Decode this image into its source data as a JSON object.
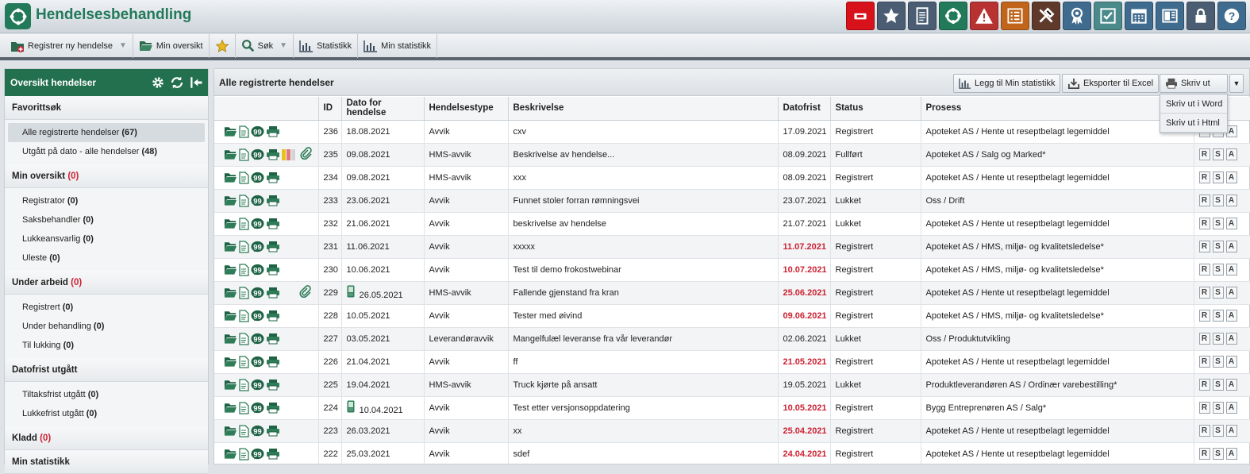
{
  "app": {
    "title": "Hendelsesbehandling"
  },
  "header_icons": [
    {
      "name": "notification-icon",
      "color": "#d8121a"
    },
    {
      "name": "star-icon",
      "color": "#4a5d73"
    },
    {
      "name": "document-icon",
      "color": "#4a5d73"
    },
    {
      "name": "cycle-icon",
      "color": "#237a5a"
    },
    {
      "name": "warning-icon",
      "color": "#b83232"
    },
    {
      "name": "list-icon",
      "color": "#c0651b"
    },
    {
      "name": "tools-icon",
      "color": "#5f3a2a"
    },
    {
      "name": "award-icon",
      "color": "#3f6b8e"
    },
    {
      "name": "checkbox-icon",
      "color": "#4a8a8a"
    },
    {
      "name": "calendar-icon",
      "color": "#3f6b8e"
    },
    {
      "name": "publish-icon",
      "color": "#3f6b8e"
    },
    {
      "name": "lock-icon",
      "color": "#4a5d73"
    },
    {
      "name": "help-icon",
      "color": "#3f6b8e"
    }
  ],
  "toolbar": {
    "register": "Registrer ny hendelse",
    "my_overview": "Min oversikt",
    "search": "Søk",
    "statistics": "Statistikk",
    "my_statistics": "Min statistikk"
  },
  "sidebar": {
    "title": "Oversikt hendelser",
    "favorites_title": "Favorittsøk",
    "favorites": [
      {
        "label": "Alle registrerte hendelser",
        "count": "(67)"
      },
      {
        "label": "Utgått på dato - alle hendelser",
        "count": "(48)"
      }
    ],
    "my_overview_title": "Min oversikt",
    "my_overview_count": "(0)",
    "my_overview": [
      {
        "label": "Registrator",
        "count": "(0)"
      },
      {
        "label": "Saksbehandler",
        "count": "(0)"
      },
      {
        "label": "Lukkeansvarlig",
        "count": "(0)"
      },
      {
        "label": "Uleste",
        "count": "(0)"
      }
    ],
    "in_progress_title": "Under arbeid",
    "in_progress_count": "(0)",
    "in_progress": [
      {
        "label": "Registrert",
        "count": "(0)"
      },
      {
        "label": "Under behandling",
        "count": "(0)"
      },
      {
        "label": "Til lukking",
        "count": "(0)"
      }
    ],
    "deadline_title": "Datofrist utgått",
    "deadline": [
      {
        "label": "Tiltaksfrist utgått",
        "count": "(0)"
      },
      {
        "label": "Lukkefrist utgått",
        "count": "(0)"
      }
    ],
    "draft_title": "Kladd",
    "draft_count": "(0)",
    "stats_title": "Min statistikk"
  },
  "main": {
    "title": "Alle registrerte hendelser",
    "add_stat": "Legg til Min statistikk",
    "export_excel": "Eksporter til Excel",
    "print": "Skriv ut",
    "print_menu": [
      "Skriv ut i Word",
      "Skriv ut i Html"
    ],
    "columns": [
      "ID",
      "Dato for hendelse",
      "Hendelsestype",
      "Beskrivelse",
      "Datofrist",
      "Status",
      "Prosess"
    ],
    "rsa": [
      "R",
      "S",
      "A"
    ],
    "rows": [
      {
        "id": "236",
        "date": "18.08.2021",
        "type": "Avvik",
        "desc": "cxv",
        "deadline": "17.09.2021",
        "late": false,
        "status": "Registrert",
        "process": "Apoteket AS / Hente ut reseptbelagt legemiddel",
        "extra": false,
        "attach": false,
        "mobile": false
      },
      {
        "id": "235",
        "date": "09.08.2021",
        "type": "HMS-avvik",
        "desc": "Beskrivelse av hendelse...",
        "deadline": "08.09.2021",
        "late": false,
        "status": "Fullført",
        "process": "Apoteket AS / Salg og Marked*",
        "extra": true,
        "attach": true,
        "mobile": false
      },
      {
        "id": "234",
        "date": "09.08.2021",
        "type": "HMS-avvik",
        "desc": "xxx",
        "deadline": "08.09.2021",
        "late": false,
        "status": "Registrert",
        "process": "Apoteket AS / Hente ut reseptbelagt legemiddel",
        "extra": false,
        "attach": false,
        "mobile": false
      },
      {
        "id": "233",
        "date": "23.06.2021",
        "type": "Avvik",
        "desc": "Funnet stoler forran rømningsvei",
        "deadline": "23.07.2021",
        "late": false,
        "status": "Lukket",
        "process": "Oss / Drift",
        "extra": false,
        "attach": false,
        "mobile": false
      },
      {
        "id": "232",
        "date": "21.06.2021",
        "type": "Avvik",
        "desc": "beskrivelse av hendelse",
        "deadline": "21.07.2021",
        "late": false,
        "status": "Lukket",
        "process": "Apoteket AS / Hente ut reseptbelagt legemiddel",
        "extra": false,
        "attach": false,
        "mobile": false
      },
      {
        "id": "231",
        "date": "11.06.2021",
        "type": "Avvik",
        "desc": "xxxxx",
        "deadline": "11.07.2021",
        "late": true,
        "status": "Registrert",
        "process": "Apoteket AS / HMS, miljø- og kvalitetsledelse*",
        "extra": false,
        "attach": false,
        "mobile": false
      },
      {
        "id": "230",
        "date": "10.06.2021",
        "type": "Avvik",
        "desc": "Test til demo frokostwebinar",
        "deadline": "10.07.2021",
        "late": true,
        "status": "Registrert",
        "process": "Apoteket AS / HMS, miljø- og kvalitetsledelse*",
        "extra": false,
        "attach": false,
        "mobile": false
      },
      {
        "id": "229",
        "date": "26.05.2021",
        "type": "HMS-avvik",
        "desc": "Fallende gjenstand fra kran",
        "deadline": "25.06.2021",
        "late": true,
        "status": "Registrert",
        "process": "Apoteket AS / Hente ut reseptbelagt legemiddel",
        "extra": false,
        "attach": true,
        "mobile": true
      },
      {
        "id": "228",
        "date": "10.05.2021",
        "type": "Avvik",
        "desc": "Tester med øivind",
        "deadline": "09.06.2021",
        "late": true,
        "status": "Registrert",
        "process": "Apoteket AS / HMS, miljø- og kvalitetsledelse*",
        "extra": false,
        "attach": false,
        "mobile": false
      },
      {
        "id": "227",
        "date": "03.05.2021",
        "type": "Leverandøravvik",
        "desc": "Mangelfulæl leveranse fra vår leverandør",
        "deadline": "02.06.2021",
        "late": false,
        "status": "Lukket",
        "process": "Oss / Produktutvikling",
        "extra": false,
        "attach": false,
        "mobile": false
      },
      {
        "id": "226",
        "date": "21.04.2021",
        "type": "Avvik",
        "desc": "ff",
        "deadline": "21.05.2021",
        "late": true,
        "status": "Registrert",
        "process": "Apoteket AS / Hente ut reseptbelagt legemiddel",
        "extra": false,
        "attach": false,
        "mobile": false
      },
      {
        "id": "225",
        "date": "19.04.2021",
        "type": "HMS-avvik",
        "desc": "Truck kjørte på ansatt",
        "deadline": "19.05.2021",
        "late": false,
        "status": "Lukket",
        "process": "Produktleverandøren AS / Ordinær varebestilling*",
        "extra": false,
        "attach": false,
        "mobile": false
      },
      {
        "id": "224",
        "date": "10.04.2021",
        "type": "Avvik",
        "desc": "Test etter versjonsoppdatering",
        "deadline": "10.05.2021",
        "late": true,
        "status": "Registrert",
        "process": "Bygg Entreprenøren AS / Salg*",
        "extra": false,
        "attach": false,
        "mobile": true
      },
      {
        "id": "223",
        "date": "26.03.2021",
        "type": "Avvik",
        "desc": "xx",
        "deadline": "25.04.2021",
        "late": true,
        "status": "Registrert",
        "process": "Apoteket AS / Hente ut reseptbelagt legemiddel",
        "extra": false,
        "attach": false,
        "mobile": false
      },
      {
        "id": "222",
        "date": "25.03.2021",
        "type": "Avvik",
        "desc": "sdef",
        "deadline": "24.04.2021",
        "late": true,
        "status": "Registrert",
        "process": "Apoteket AS / Hente ut reseptbelagt legemiddel",
        "extra": false,
        "attach": false,
        "mobile": false
      }
    ]
  }
}
